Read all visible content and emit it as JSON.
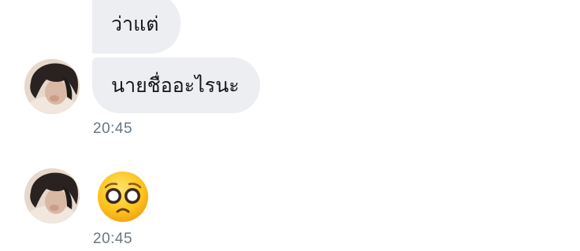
{
  "messages": [
    {
      "text": "ว่าแต่",
      "type": "text"
    },
    {
      "text": "นายชื่ออะไรนะ",
      "type": "text",
      "timestamp": "20:45"
    },
    {
      "emoji": "pleading-face-emoji",
      "type": "emoji",
      "timestamp": "20:45"
    }
  ],
  "colors": {
    "bubble_background": "#eceef1",
    "message_text": "#14171a",
    "timestamp_text": "#657786"
  }
}
